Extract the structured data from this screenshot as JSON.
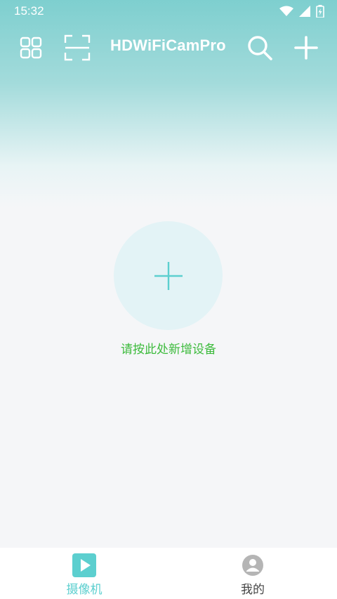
{
  "status_bar": {
    "time": "15:32"
  },
  "toolbar": {
    "title": "HDWiFiCamPro",
    "icons": [
      "grid-icon",
      "scan-icon",
      "search-icon",
      "plus-icon"
    ]
  },
  "main": {
    "add_device_hint": "请按此处新增设备"
  },
  "bottom_nav": {
    "items": [
      {
        "label": "摄像机",
        "icon": "camera-play-icon",
        "active": true
      },
      {
        "label": "我的",
        "icon": "profile-icon",
        "active": false
      }
    ]
  },
  "colors": {
    "accent": "#5ccfcf",
    "header": "#7ecfcf",
    "hint_text": "#3dbb3d",
    "add_circle": "#e3f3f6"
  }
}
